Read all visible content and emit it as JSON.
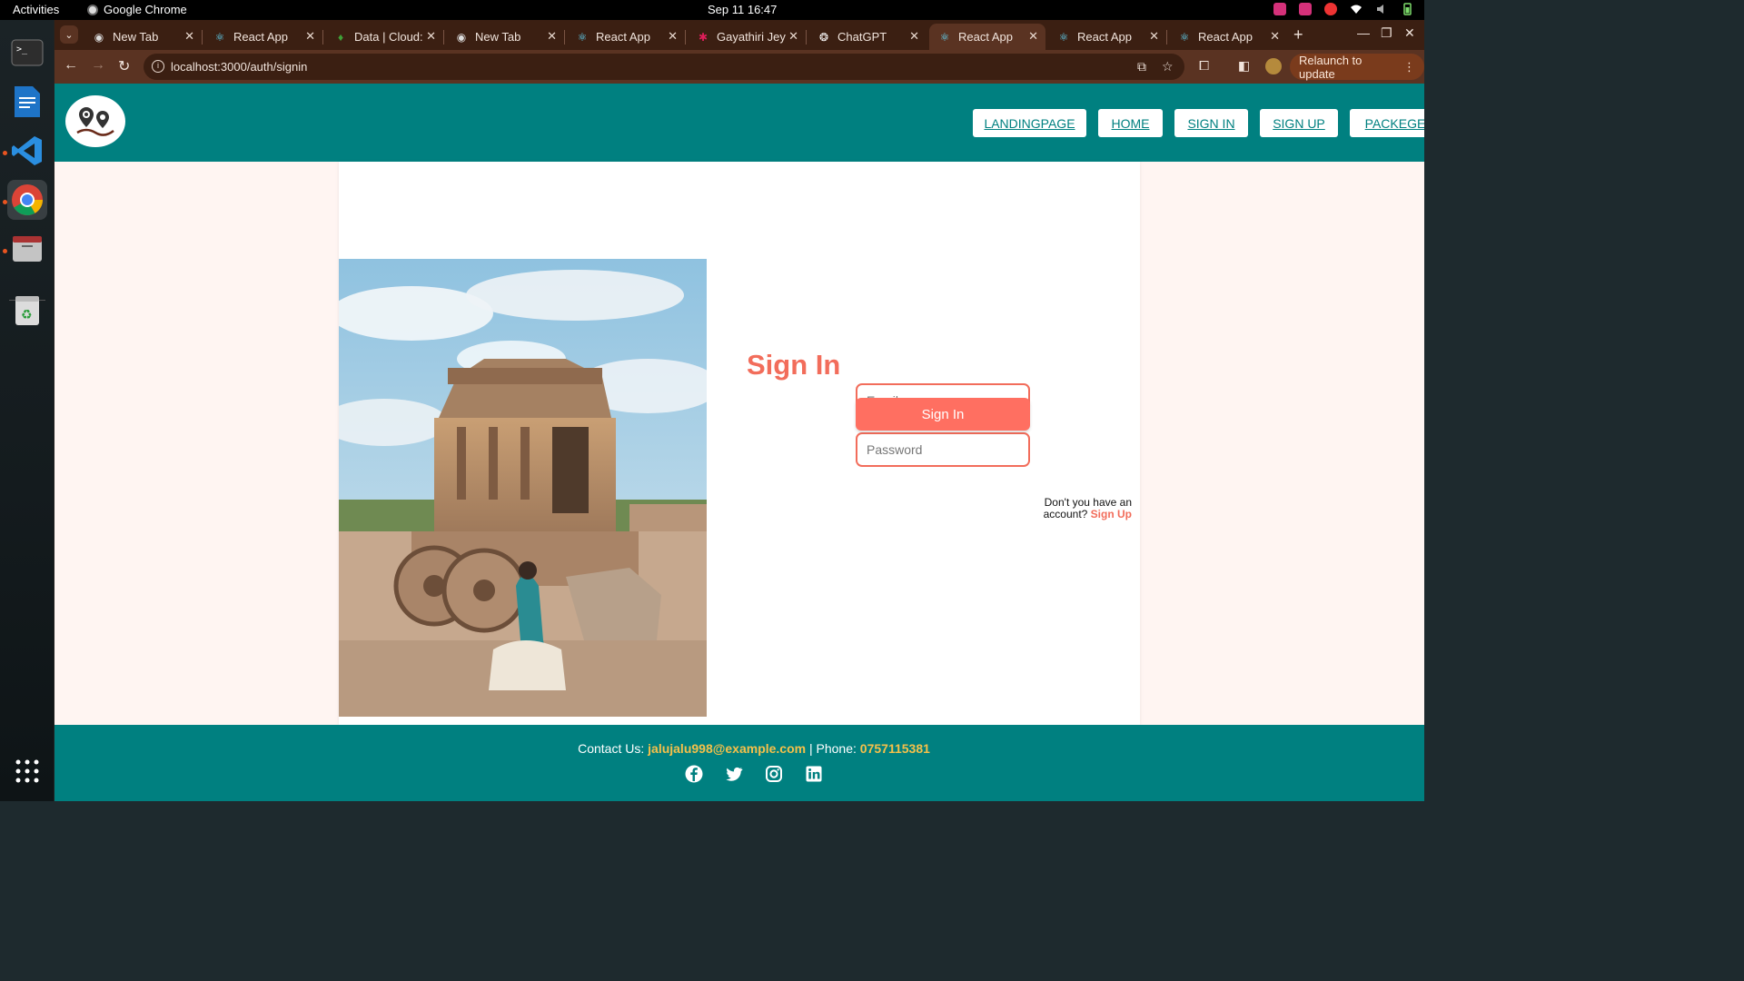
{
  "system": {
    "activities": "Activities",
    "app_name": "Google Chrome",
    "clock": "Sep 11  16:47"
  },
  "tabs": [
    {
      "label": "New Tab",
      "icon": "chrome-icon"
    },
    {
      "label": "React App",
      "icon": "react-icon"
    },
    {
      "label": "Data | Cloud:",
      "icon": "mongodb-leaf-icon"
    },
    {
      "label": "New Tab",
      "icon": "chrome-icon"
    },
    {
      "label": "React App",
      "icon": "react-icon"
    },
    {
      "label": "Gayathiri Jey",
      "icon": "slack-icon"
    },
    {
      "label": "ChatGPT",
      "icon": "openai-icon"
    },
    {
      "label": "React App",
      "icon": "react-icon",
      "active": true
    },
    {
      "label": "React App",
      "icon": "react-icon"
    },
    {
      "label": "React App",
      "icon": "react-icon"
    }
  ],
  "browser": {
    "url": "localhost:3000/auth/signin",
    "relaunch_label": "Relaunch to update"
  },
  "nav": {
    "links": [
      "LANDINGPAGE",
      "HOME",
      "SIGN IN",
      "SIGN UP",
      "PACKEGE"
    ]
  },
  "signin": {
    "title": "Sign In",
    "email_placeholder": "Email",
    "password_placeholder": "Password",
    "button_label": "Sign In",
    "no_account_text": "Don't you have an account?",
    "signup_link": "Sign Up"
  },
  "footer": {
    "contact_label": "Contact Us:",
    "email": "jalujalu998@example.com",
    "phone_label": "| Phone:",
    "phone": "0757115381",
    "social": [
      "facebook-icon",
      "twitter-icon",
      "instagram-icon",
      "linkedin-icon"
    ]
  },
  "colors": {
    "header_teal": "#008080",
    "accent_coral": "#ff6f61",
    "footer_highlight": "#f5c04a",
    "page_bg": "#fff5f2"
  }
}
